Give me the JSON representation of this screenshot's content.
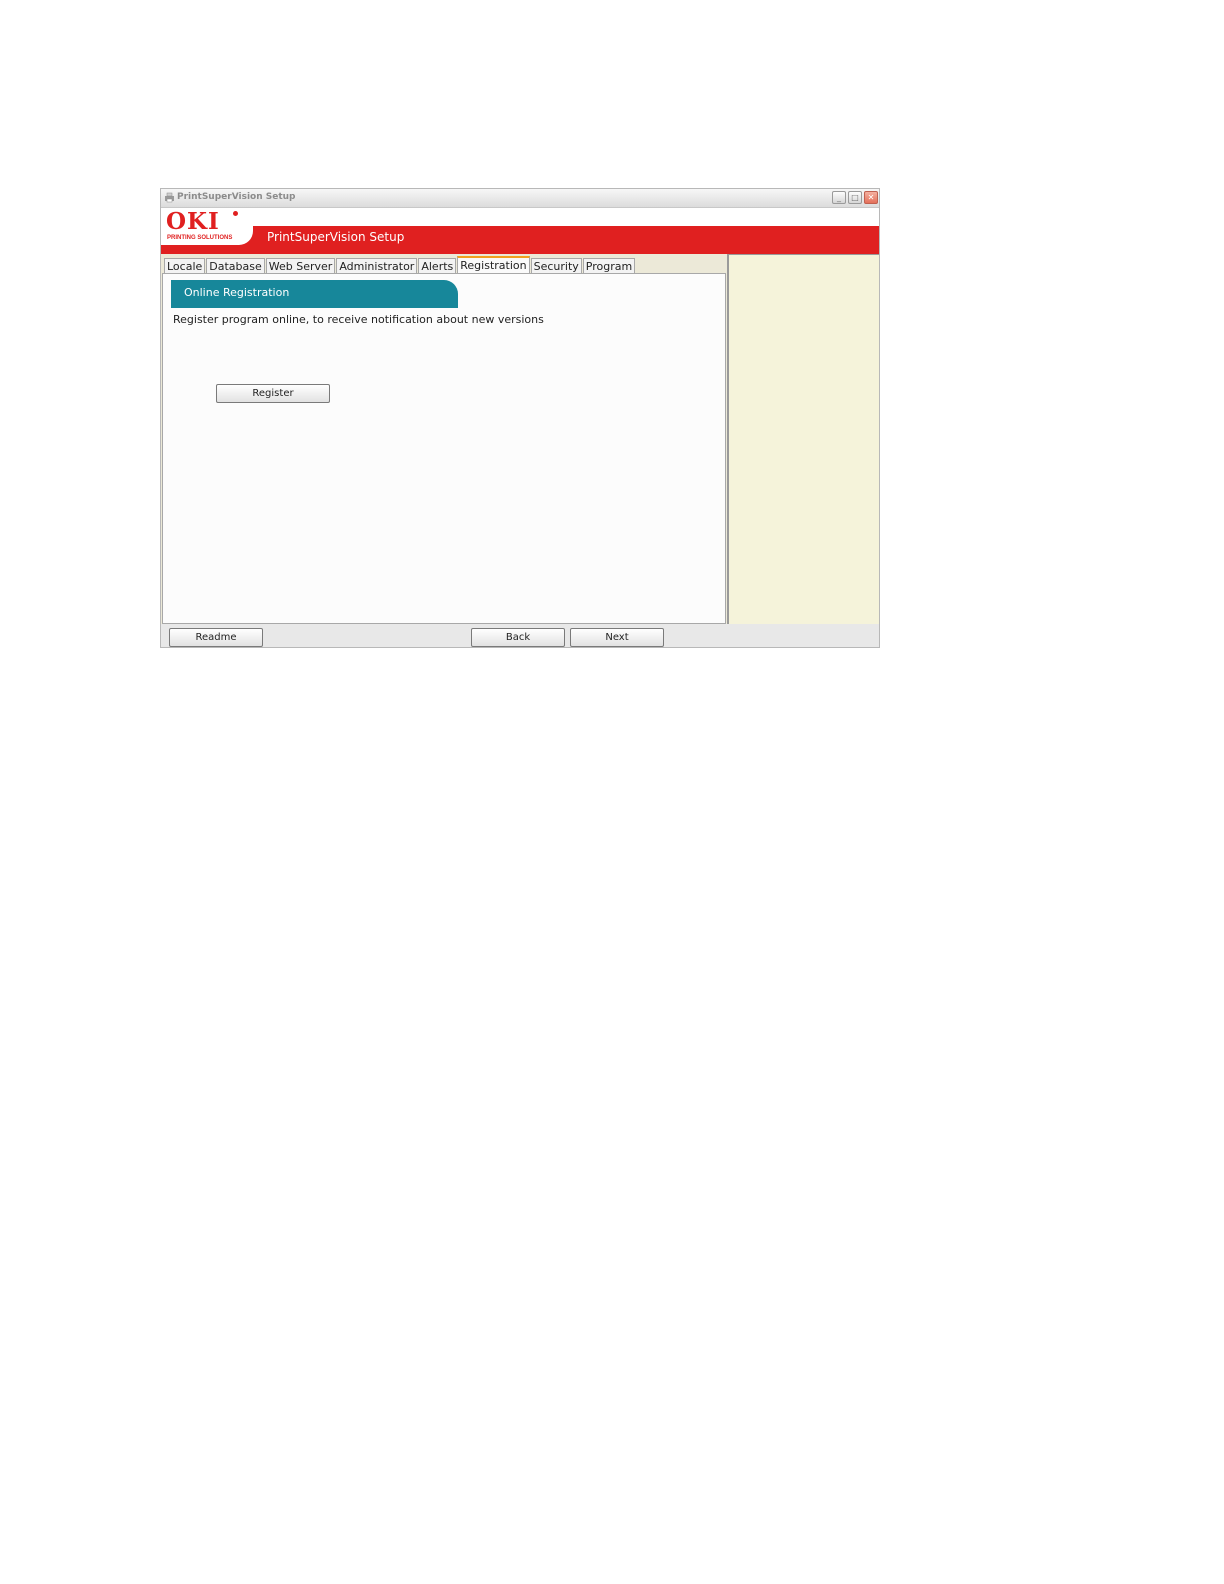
{
  "window": {
    "title": "PrintSuperVision Setup",
    "controls": {
      "minimize": "_",
      "maximize": "□",
      "close": "✕"
    }
  },
  "banner": {
    "logo_text": "OKI",
    "logo_subtext": "PRINTING SOLUTIONS",
    "title": "PrintSuperVision Setup"
  },
  "tabs": [
    {
      "label": "Locale"
    },
    {
      "label": "Database"
    },
    {
      "label": "Web Server"
    },
    {
      "label": "Administrator"
    },
    {
      "label": "Alerts"
    },
    {
      "label": "Registration",
      "active": true
    },
    {
      "label": "Security"
    },
    {
      "label": "Program"
    }
  ],
  "section": {
    "title": "Online Registration",
    "description": "Register program online, to receive notification about new versions",
    "register_label": "Register"
  },
  "footer": {
    "readme_label": "Readme",
    "back_label": "Back",
    "next_label": "Next"
  },
  "colors": {
    "brand_red": "#e02020",
    "section_teal": "#17879a",
    "side_panel": "#f5f3da"
  }
}
